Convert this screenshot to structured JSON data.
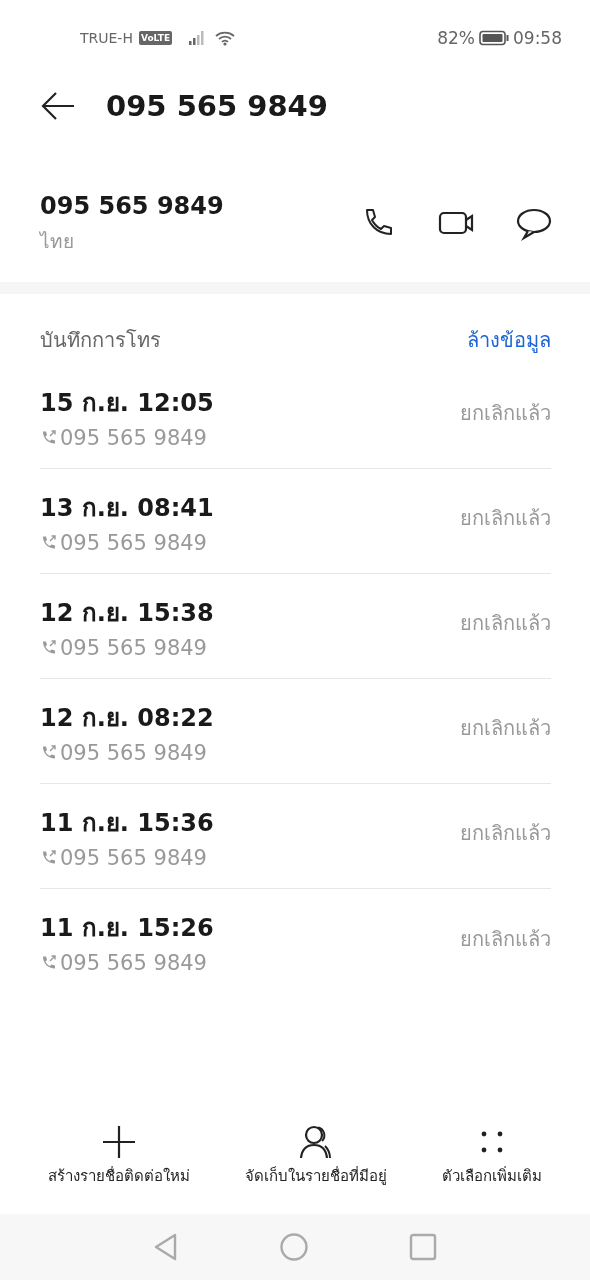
{
  "status_bar": {
    "carrier": "TRUE-H",
    "volte": "VoLTE",
    "battery_percent": "82%",
    "time": "09:58"
  },
  "header": {
    "title": "095 565 9849"
  },
  "contact": {
    "number": "095 565 9849",
    "region": "ไทย"
  },
  "call_log": {
    "title": "บันทึกการโทร",
    "clear_link": "ล้างข้อมูล",
    "entries": [
      {
        "datetime": "15 ก.ย. 12:05",
        "number": "095 565 9849",
        "status": "ยกเลิกแล้ว"
      },
      {
        "datetime": "13 ก.ย. 08:41",
        "number": "095 565 9849",
        "status": "ยกเลิกแล้ว"
      },
      {
        "datetime": "12 ก.ย. 15:38",
        "number": "095 565 9849",
        "status": "ยกเลิกแล้ว"
      },
      {
        "datetime": "12 ก.ย. 08:22",
        "number": "095 565 9849",
        "status": "ยกเลิกแล้ว"
      },
      {
        "datetime": "11 ก.ย. 15:36",
        "number": "095 565 9849",
        "status": "ยกเลิกแล้ว"
      },
      {
        "datetime": "11 ก.ย. 15:26",
        "number": "095 565 9849",
        "status": "ยกเลิกแล้ว"
      }
    ]
  },
  "bottom_actions": [
    {
      "kind": "add",
      "label": "สร้างรายชื่อติดต่อใหม่"
    },
    {
      "kind": "contacts",
      "label": "จัดเก็บในรายชื่อที่มีอยู่"
    },
    {
      "kind": "more",
      "label": "ตัวเลือกเพิ่มเติม"
    }
  ]
}
